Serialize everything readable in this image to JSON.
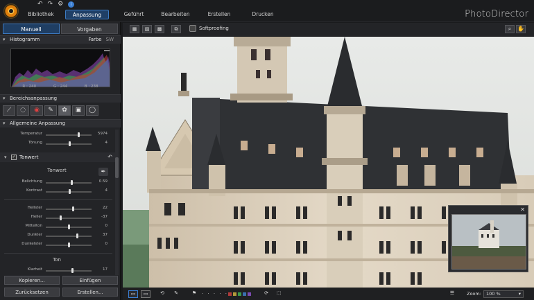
{
  "app": {
    "brand": "PhotoDirector"
  },
  "modes": [
    {
      "label": "Bibliothek",
      "active": false
    },
    {
      "label": "Anpassung",
      "active": true
    },
    {
      "label": "Geführt",
      "active": false
    },
    {
      "label": "Bearbeiten",
      "active": false
    },
    {
      "label": "Erstellen",
      "active": false
    },
    {
      "label": "Drucken",
      "active": false
    }
  ],
  "panel_tabs": [
    {
      "label": "Manuell",
      "active": true
    },
    {
      "label": "Vorgaben",
      "active": false
    }
  ],
  "histogram": {
    "title": "Histogramm",
    "mode_color": "Farbe",
    "mode_bw": "SW",
    "r": "R : 240",
    "g": "G : 244",
    "b": "B : 238"
  },
  "bereich": {
    "title": "Bereichsanpassung",
    "tools": [
      "crop-icon",
      "gradient-icon",
      "red-eye-icon",
      "brush-icon",
      "spot-removal-icon",
      "frame-icon",
      "circle-icon"
    ]
  },
  "allgemein": {
    "title": "Allgemeine Anpassung",
    "sliders": [
      {
        "label": "Temperatur",
        "value": "5974",
        "pos": 0.72
      },
      {
        "label": "Tönung",
        "value": "4",
        "pos": 0.52
      }
    ]
  },
  "tonwert": {
    "title": "Tonwert",
    "subtitle": "Tonwert",
    "sliders1": [
      {
        "label": "Belichtung",
        "value": "0.59",
        "pos": 0.56
      },
      {
        "label": "Kontrast",
        "value": "4",
        "pos": 0.52
      }
    ],
    "sliders2": [
      {
        "label": "Hellster",
        "value": "22",
        "pos": 0.6
      },
      {
        "label": "Heller",
        "value": "-37",
        "pos": 0.31
      },
      {
        "label": "Mittelton",
        "value": "0",
        "pos": 0.5
      },
      {
        "label": "Dunkler",
        "value": "37",
        "pos": 0.68
      },
      {
        "label": "Dunkelster",
        "value": "0",
        "pos": 0.5
      }
    ],
    "ton_title": "Ton",
    "sliders3": [
      {
        "label": "Klarheit",
        "value": "17",
        "pos": 0.58
      }
    ]
  },
  "buttons": {
    "copy": "Kopieren...",
    "paste": "Einfügen",
    "reset": "Zurücksetzen",
    "create": "Erstellen..."
  },
  "toolbar": {
    "softproof": "Softproofing"
  },
  "status": {
    "zoom_label": "Zoom:",
    "zoom_value": "100 %",
    "swatch_colors": [
      "#c23b3b",
      "#c2a03b",
      "#3bb04a",
      "#3b7fc2",
      "#8a4bc2"
    ]
  },
  "colors": {
    "accent": "#3d7cc4"
  }
}
